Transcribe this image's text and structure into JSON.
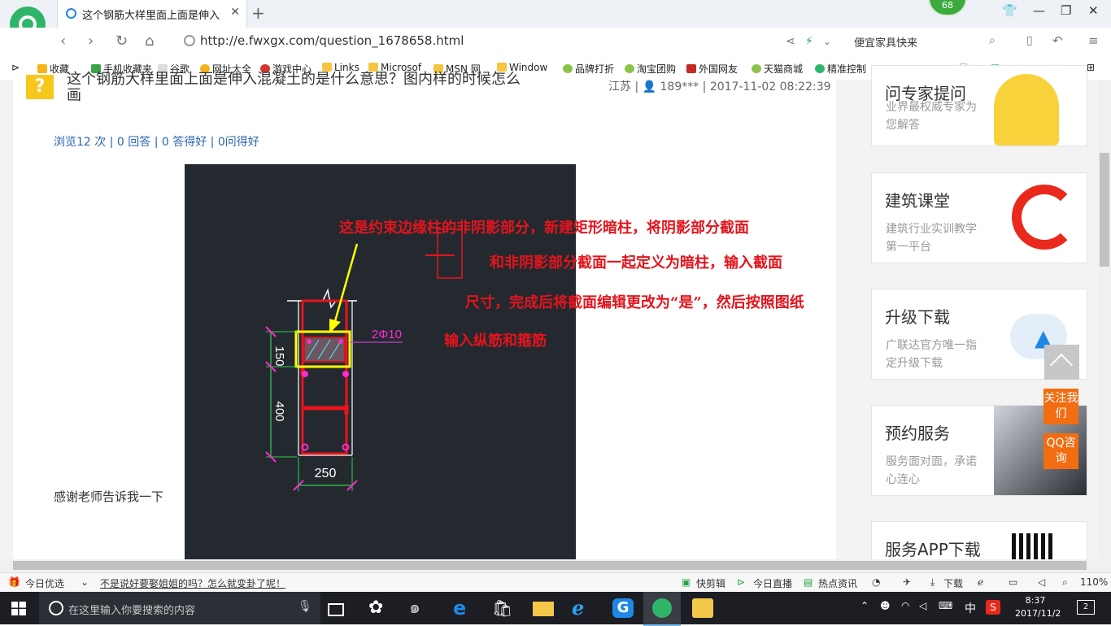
{
  "browser": {
    "tab_title": "这个钢筋大样里面上面是伸入混凝",
    "tab_close": "✕",
    "new_tab": "+",
    "badge": "68",
    "url": "http://e.fwxgx.com/question_1678658.html",
    "search_text": "便宜家具快来",
    "bookmarks": [
      "收藏",
      "手机收藏夹",
      "谷歌",
      "网址大全",
      "游戏中心",
      "Links",
      "Microsof",
      "MSN 网",
      "Window",
      "品牌打折",
      "淘宝团购",
      "外国网友",
      "天猫商城",
      "精准控制"
    ],
    "zoom": "110%"
  },
  "question": {
    "title": "这个钢筋大样里面上面是伸入混凝土的是什么意思？图内样的时候怎么画",
    "meta": "江苏 | 👤 189*** | 2017-11-02 08:22:39",
    "stats": "浏览12 次 | 0 回答 | 0 答得好 | 0问得好",
    "thanks": "感谢老师告诉我一下"
  },
  "cad": {
    "dim_150": "150",
    "dim_400": "400",
    "dim_250": "250",
    "rebar_label": "2Φ10",
    "annotation_lines": [
      "这是约束边缘柱的非阴影部分，新建矩形暗柱，将阴影部分截面",
      "和非阴影部分截面一起定义为暗柱，输入截面",
      "尺寸，完成后将截面编辑更改为“是”，然后按照图纸",
      "输入纵筋和箍筋"
    ]
  },
  "sidebar": {
    "cards": [
      {
        "title": "问专家提问",
        "desc": "业界最权威专家为您解答"
      },
      {
        "title": "建筑课堂",
        "desc": "建筑行业实训教学第一平台"
      },
      {
        "title": "升级下载",
        "desc": "广联达官方唯一指定升级下载"
      },
      {
        "title": "预约服务",
        "desc": "服务面对面，承诺心连心"
      },
      {
        "title": "服务APP下载",
        "desc": ""
      }
    ],
    "follow": "关注我们",
    "qq": "QQ咨询"
  },
  "statusbar": {
    "today": "今日优选",
    "headline": "不是说好要娶姐姐的吗？怎么就变卦了呢！",
    "kuaijianji": "快剪辑",
    "live": "今日直播",
    "news": "热点资讯",
    "download": "下载"
  },
  "taskbar": {
    "search_placeholder": "在这里输入你要搜索的内容",
    "ime": "中",
    "time": "8:37",
    "date": "2017/11/2",
    "notif_count": "2"
  }
}
